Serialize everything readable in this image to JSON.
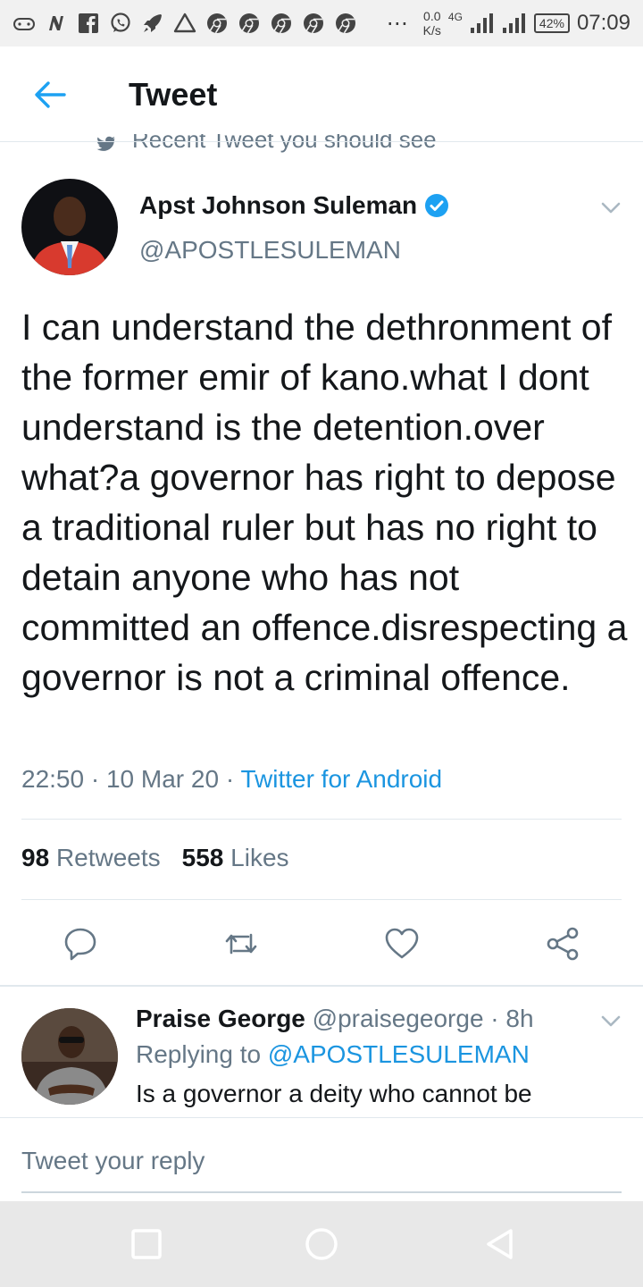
{
  "status_bar": {
    "dots": "⋯",
    "speed_value": "0.0",
    "speed_unit": "K/s",
    "network": "4G",
    "battery": "42%",
    "time": "07:09",
    "icons": [
      "game-controller-icon",
      "n-app-icon",
      "facebook-icon",
      "whatsapp-icon",
      "rocket-icon",
      "alert-icon",
      "chrome-icon",
      "chrome-icon",
      "chrome-icon",
      "chrome-icon",
      "chrome-icon"
    ]
  },
  "header": {
    "title": "Tweet",
    "accent": "#1da1f2"
  },
  "recent_label": "Recent Tweet you should see",
  "tweet": {
    "author_name": "Apst Johnson Suleman",
    "handle": "@APOSTLESULEMAN",
    "text": "I can understand the dethronment of the  former emir of kano.what I dont understand is the detention.over what?a governor has right to depose a traditional ruler but has no right to detain anyone who has not committed an offence.disrespecting a governor is not a criminal offence.",
    "time": "22:50",
    "sep1": " · ",
    "date": "10 Mar 20",
    "sep2": " · ",
    "source": "Twitter for Android",
    "retweets_count": "98",
    "retweets_label": "Retweets",
    "likes_count": "558",
    "likes_label": "Likes"
  },
  "reply": {
    "name": "Praise George",
    "handle": "@praisegeorge",
    "dot": " · ",
    "age": "8h",
    "replying_label": "Replying to",
    "replying_handle": "@APOSTLESULEMAN",
    "text": "Is a governor a deity who cannot be"
  },
  "compose": {
    "placeholder": "Tweet your reply"
  },
  "colors": {
    "link": "#1b95e0",
    "muted": "#657786",
    "text": "#14171a"
  }
}
